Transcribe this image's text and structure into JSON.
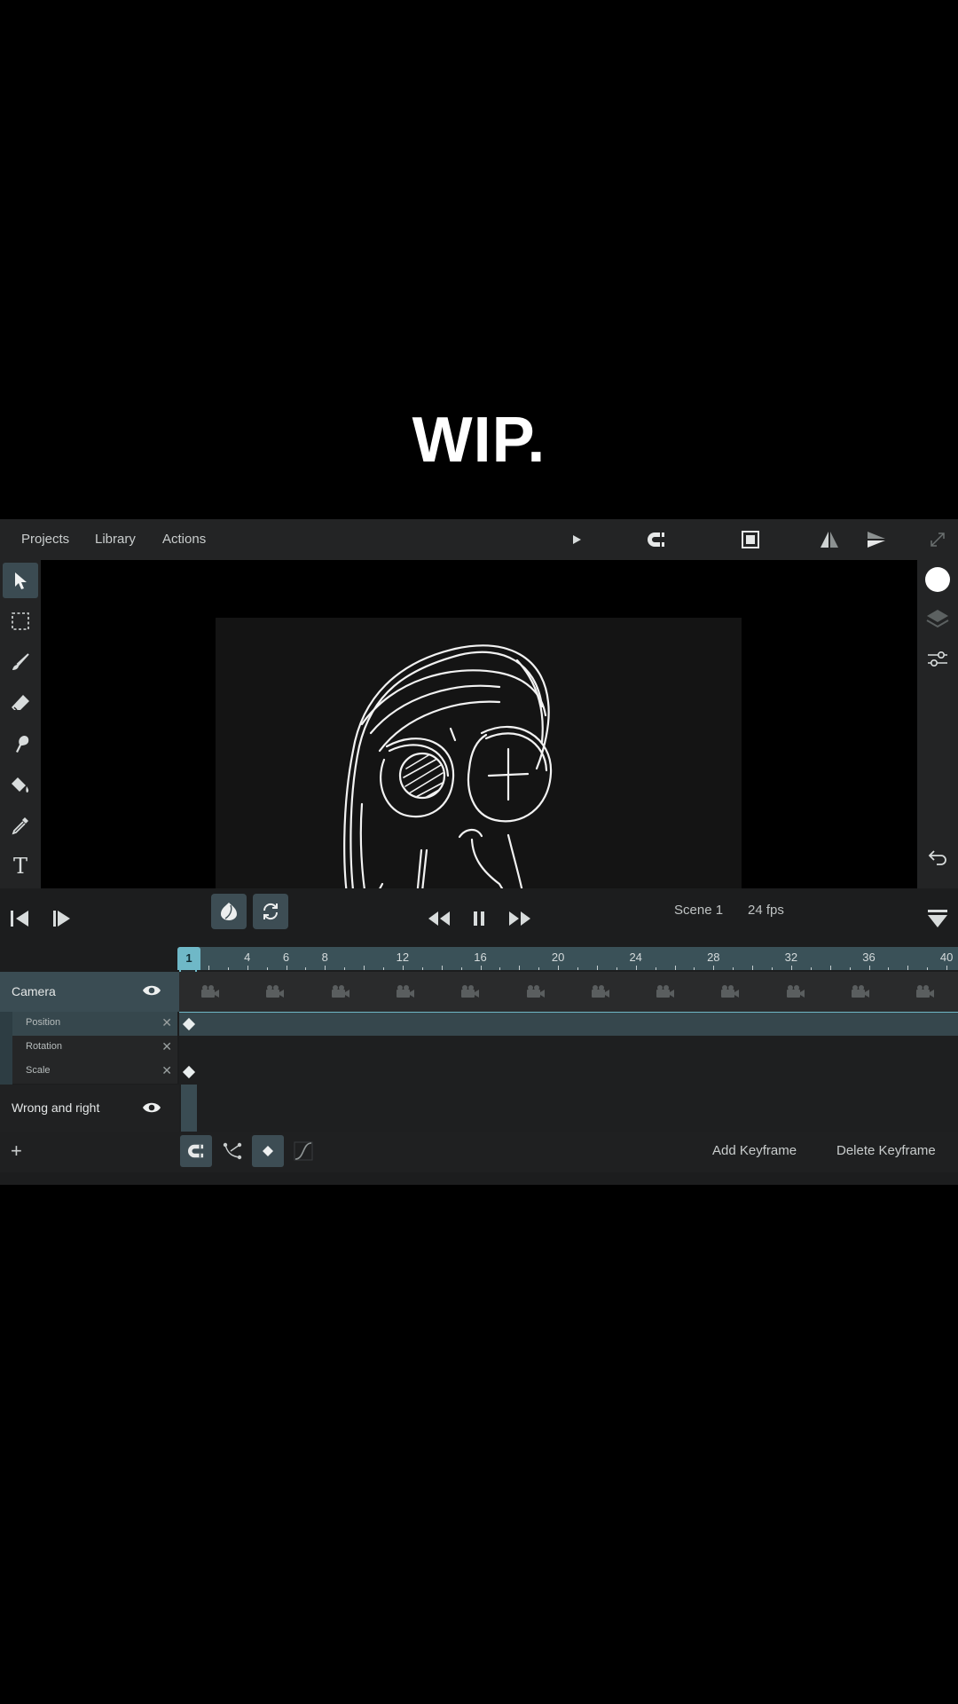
{
  "caption": "WIP.",
  "menu": {
    "projects": "Projects",
    "library": "Library",
    "actions": "Actions"
  },
  "toolbar_icons": [
    "play-icon",
    "magnet-icon",
    "canvas-size-icon",
    "flip-horizontal-icon",
    "flip-vertical-icon",
    "expand-icon"
  ],
  "left_tools": [
    "select-tool",
    "marquee-tool",
    "brush-tool",
    "eraser-tool",
    "smudge-tool",
    "fill-tool",
    "eyedropper-tool",
    "text-tool"
  ],
  "right_tools": [
    "color-swatch",
    "layers-icon",
    "adjustments-icon",
    "undo-icon"
  ],
  "playback": {
    "scene": "Scene 1",
    "fps": "24 fps"
  },
  "timeline": {
    "current_frame": "1",
    "ruler_labels": [
      "4",
      "6",
      "8",
      "12",
      "16",
      "20",
      "24",
      "28",
      "32",
      "36",
      "40"
    ],
    "layers": [
      {
        "name": "Camera",
        "properties": [
          "Position",
          "Rotation",
          "Scale"
        ]
      },
      {
        "name": "Wrong and right"
      }
    ]
  },
  "bottom": {
    "add_keyframe": "Add Keyframe",
    "delete_keyframe": "Delete Keyframe",
    "add_layer_symbol": "+"
  },
  "colors": {
    "accent": "#6fb8c7",
    "panel": "#232425",
    "ruler": "#3a5158",
    "active_tool": "#3b4b52"
  }
}
